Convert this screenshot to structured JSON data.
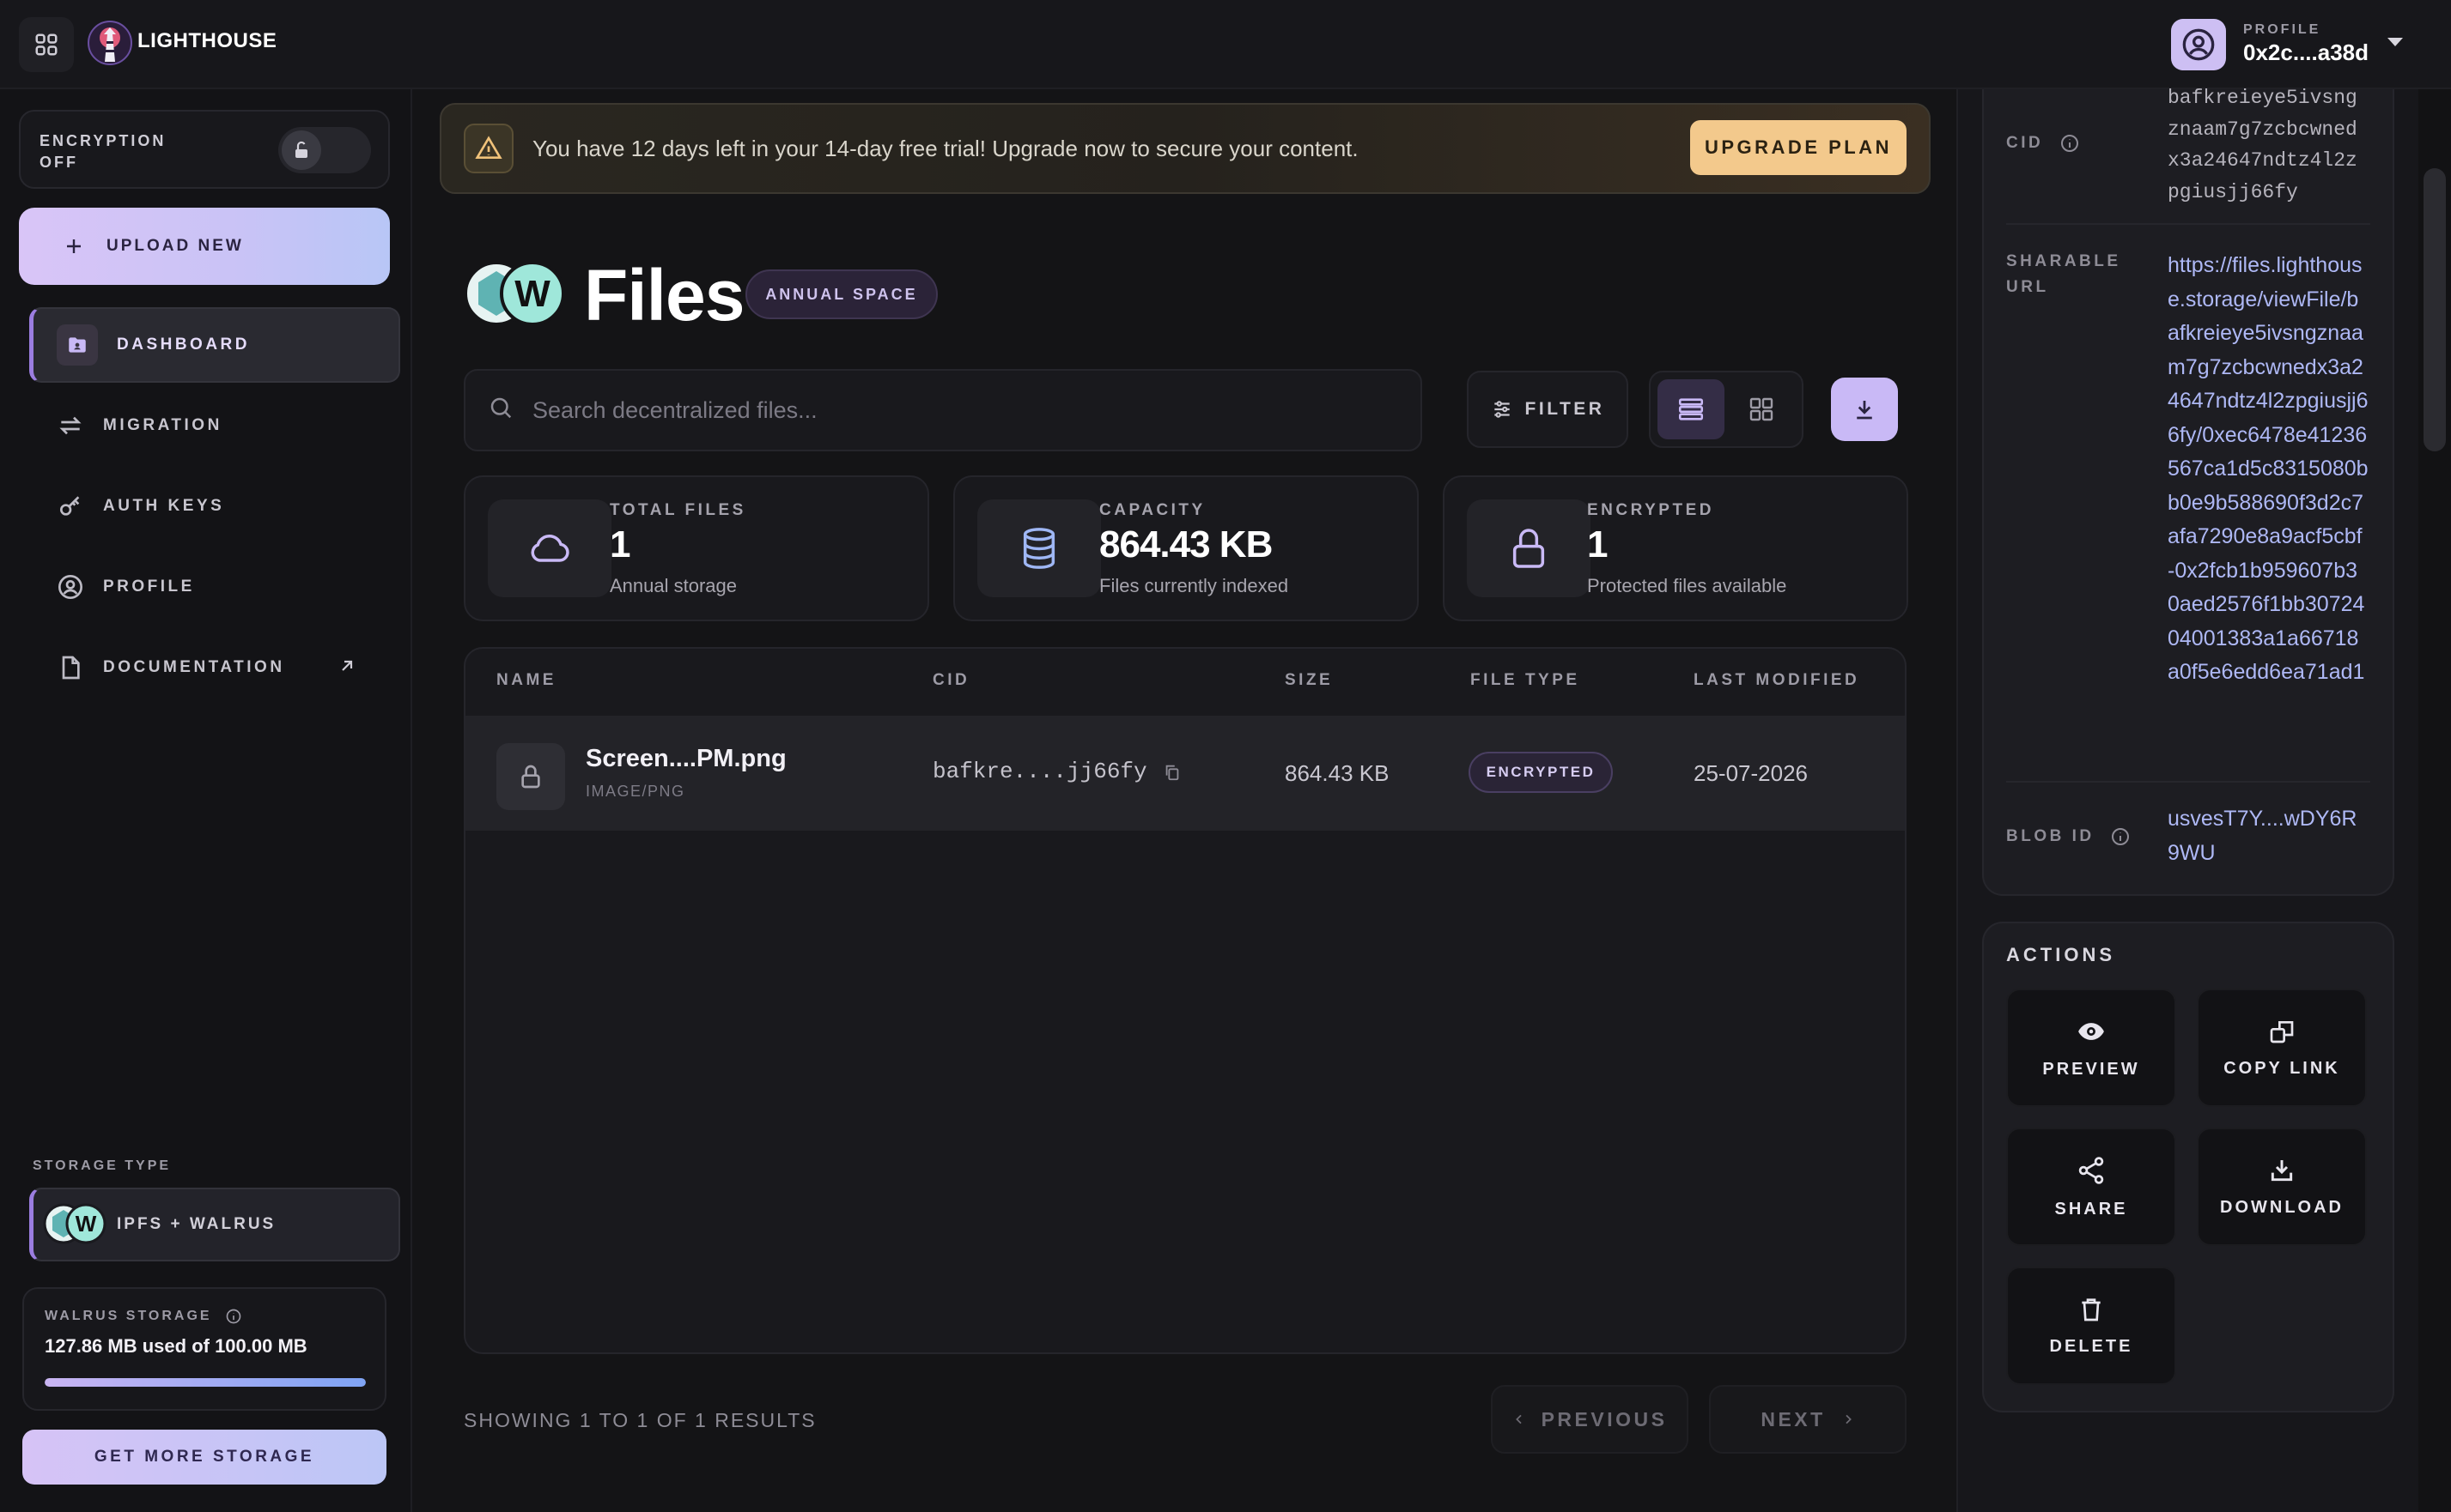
{
  "app": {
    "brand": "LIGHTHOUSE",
    "profile_caption": "PROFILE",
    "profile_address": "0x2c....a38d"
  },
  "sidebar": {
    "encryption_label": "ENCRYPTION OFF",
    "upload_label": "UPLOAD NEW",
    "nav": [
      {
        "label": "DASHBOARD",
        "icon": "folder-user-icon",
        "active": true
      },
      {
        "label": "MIGRATION",
        "icon": "swap-arrows-icon"
      },
      {
        "label": "AUTH KEYS",
        "icon": "key-icon"
      },
      {
        "label": "PROFILE",
        "icon": "user-circle-icon"
      },
      {
        "label": "DOCUMENTATION",
        "icon": "document-icon",
        "external": true
      }
    ],
    "storage_type_caption": "STORAGE TYPE",
    "storage_type_value": "IPFS + WALRUS",
    "walrus_caption": "WALRUS STORAGE",
    "walrus_usage": "127.86 MB used of 100.00 MB",
    "walrus_fill_fraction": 1.0,
    "more_storage_label": "GET MORE STORAGE"
  },
  "banner": {
    "text": "You have 12 days left in your 14-day free trial! Upgrade now to secure your content.",
    "upgrade_label": "UPGRADE PLAN"
  },
  "main": {
    "title": "Files",
    "space_badge": "ANNUAL SPACE",
    "search_placeholder": "Search decentralized files...",
    "filter_label": "FILTER",
    "stats": [
      {
        "caption": "TOTAL FILES",
        "value": "1",
        "sub": "Annual storage",
        "icon": "cloud-icon"
      },
      {
        "caption": "CAPACITY",
        "value": "864.43 KB",
        "sub": "Files currently indexed",
        "icon": "database-icon"
      },
      {
        "caption": "ENCRYPTED",
        "value": "1",
        "sub": "Protected files available",
        "icon": "lock-icon"
      }
    ],
    "table": {
      "headers": [
        "NAME",
        "CID",
        "SIZE",
        "FILE TYPE",
        "LAST MODIFIED"
      ],
      "rows": [
        {
          "name": "Screen....PM.png",
          "mime": "IMAGE/PNG",
          "cid": "bafkre....jj66fy",
          "size": "864.43 KB",
          "type_badge": "ENCRYPTED",
          "modified": "25-07-2026"
        }
      ]
    },
    "results_text": "SHOWING 1 TO 1 OF 1 RESULTS",
    "prev_label": "PREVIOUS",
    "next_label": "NEXT"
  },
  "details": {
    "cid_label": "CID",
    "cid_value": "bafkreieye5ivsngznaam7g7zcbcwnedx3a24647ndtz4l2zpgiusjj66fy",
    "url_label": "SHARABLE URL",
    "url_value": "https://files.lighthouse.storage/viewFile/bafkreieye5ivsngznaam7g7zcbcwnedx3a24647ndtz4l2zpgiusjj66fy/0xec6478e41236567ca1d5c8315080bb0e9b588690f3d2c7afa7290e8a9acf5cbf-0x2fcb1b959607b30aed2576f1bb3072404001383a1a66718a0f5e6edd6ea71ad1",
    "blob_label": "BLOB ID",
    "blob_value": "usvesT7Y....wDY6R9WU"
  },
  "actions": {
    "caption": "ACTIONS",
    "items": [
      {
        "label": "PREVIEW",
        "icon": "eye-icon"
      },
      {
        "label": "COPY LINK",
        "icon": "copy-icon"
      },
      {
        "label": "SHARE",
        "icon": "share-icon"
      },
      {
        "label": "DOWNLOAD",
        "icon": "download-icon"
      },
      {
        "label": "DELETE",
        "icon": "trash-icon"
      }
    ]
  }
}
